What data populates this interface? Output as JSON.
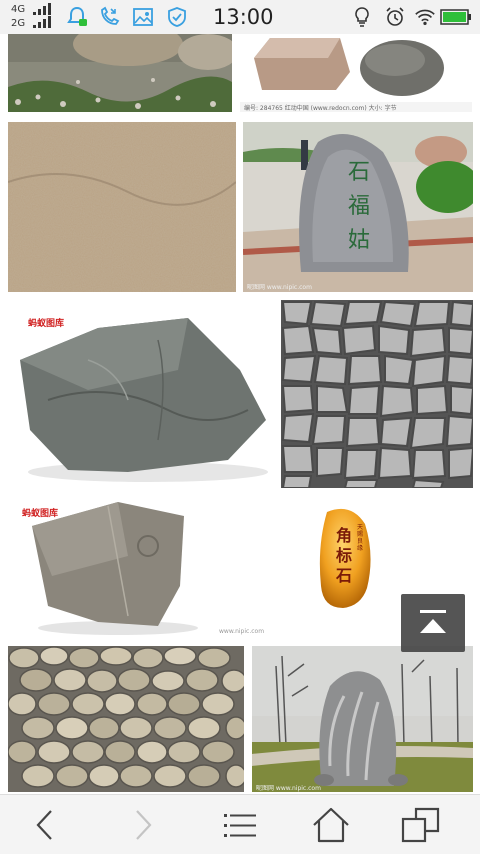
{
  "status_bar": {
    "network_top": "4G",
    "network_bottom": "2G",
    "time": "13:00"
  },
  "images": [
    {
      "name": "garden-rocks",
      "watermark": ""
    },
    {
      "name": "two-stones",
      "watermark": "编号: 284765  红动中国 (www.redocn.com)  大小: 字节"
    },
    {
      "name": "rough-stone-texture",
      "watermark": ""
    },
    {
      "name": "engraved-monument",
      "watermark": "昵图网 www.nipic.com",
      "carving": "石福姑"
    },
    {
      "name": "grey-rock-fossil",
      "logo": "蚂蚁图库",
      "watermark": ""
    },
    {
      "name": "stone-mosaic",
      "watermark": ""
    },
    {
      "name": "granite-chunk",
      "logo": "蚂蚁图库",
      "watermark": ""
    },
    {
      "name": "amber-stone",
      "carving": "角标石",
      "side_text": "天赐良缘",
      "watermark": "www.nipic.com"
    },
    {
      "name": "cobblestone-wall",
      "watermark": ""
    },
    {
      "name": "park-stone",
      "watermark": "昵图网 www.nipic.com"
    }
  ],
  "colors": {
    "status_bg": "#f2f2f2",
    "nav_bg": "#f4f4f4",
    "accent_blue": "#3aa0e0",
    "battery_green": "#2fbf3a",
    "backtop_bg": "#464646"
  },
  "nav": {
    "back_icon": "chevron-left-icon",
    "forward_icon": "chevron-right-icon",
    "menu_icon": "menu-icon",
    "home_icon": "home-icon",
    "tabs_icon": "tabs-icon"
  }
}
